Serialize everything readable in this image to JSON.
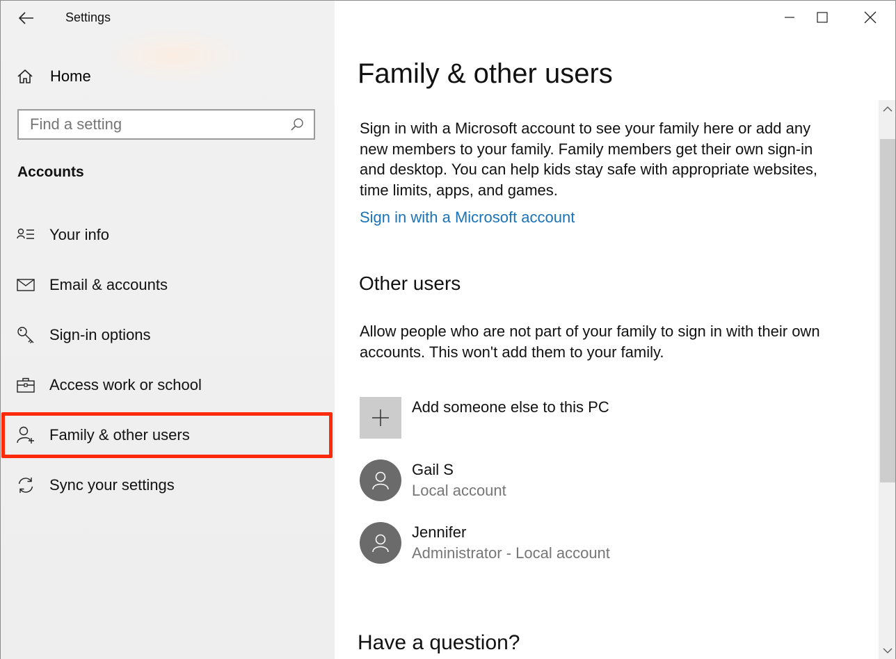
{
  "app": {
    "title": "Settings"
  },
  "sidebar": {
    "home_label": "Home",
    "search_placeholder": "Find a setting",
    "section_label": "Accounts",
    "items": [
      {
        "label": "Your info",
        "icon": "person-list-icon"
      },
      {
        "label": "Email & accounts",
        "icon": "mail-icon"
      },
      {
        "label": "Sign-in options",
        "icon": "key-icon"
      },
      {
        "label": "Access work or school",
        "icon": "briefcase-icon"
      },
      {
        "label": "Family & other users",
        "icon": "person-add-icon",
        "selected": true
      },
      {
        "label": "Sync your settings",
        "icon": "sync-icon"
      }
    ]
  },
  "main": {
    "title": "Family & other users",
    "family_description": "Sign in with a Microsoft account to see your family here or add any new members to your family. Family members get their own sign-in and desktop. You can help kids stay safe with appropriate websites, time limits, apps, and games.",
    "signin_link": "Sign in with a Microsoft account",
    "other_users_heading": "Other users",
    "other_users_description": "Allow people who are not part of your family to sign in with their own accounts. This won't add them to your family.",
    "add_label": "Add someone else to this PC",
    "users": [
      {
        "name": "Gail S",
        "type": "Local account"
      },
      {
        "name": "Jennifer",
        "type": "Administrator - Local account"
      }
    ],
    "question_heading": "Have a question?"
  },
  "colors": {
    "highlight_border": "#ff2a0a",
    "link": "#1a73b8",
    "avatar_bg": "#6b6b6b",
    "sidebar_bg": "#efefef"
  }
}
